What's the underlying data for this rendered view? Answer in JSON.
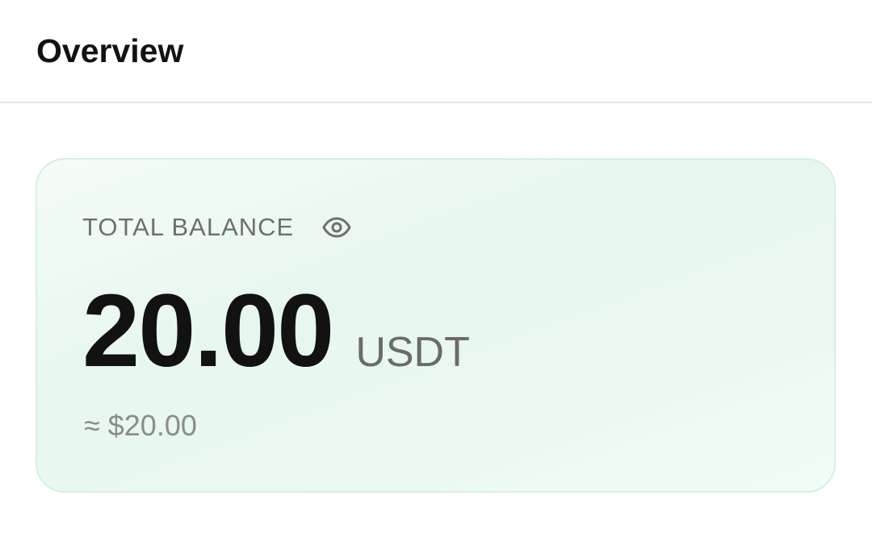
{
  "header": {
    "title": "Overview"
  },
  "balance_card": {
    "label": "TOTAL BALANCE",
    "visibility_icon": "eye-icon",
    "amount": "20.00",
    "currency": "USDT",
    "fiat_equivalent": "≈ $20.00"
  },
  "colors": {
    "card_background": "#e7f7ed",
    "card_border": "#d7f0df",
    "primary_text": "#121212",
    "secondary_text": "#6f6f6f",
    "divider": "#e6e6e6"
  }
}
